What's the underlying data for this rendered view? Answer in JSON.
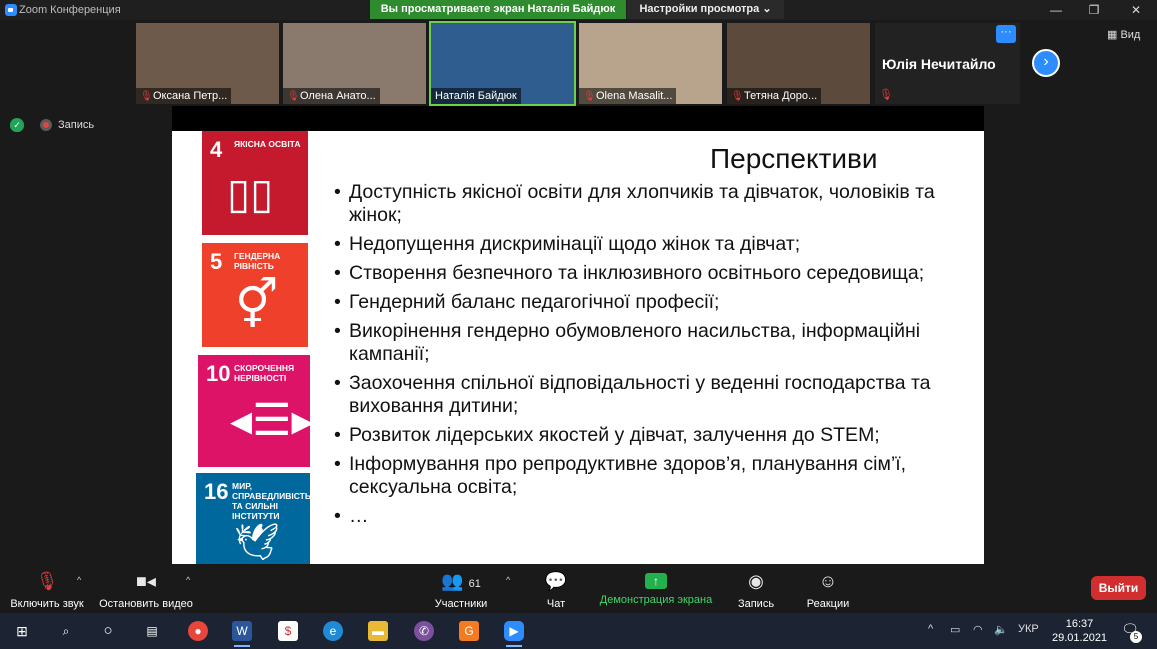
{
  "window": {
    "title": "Zoom Конференция",
    "share_banner": "Вы просматриваете экран Наталія Байдюк",
    "view_options": "Настройки просмотра ⌄",
    "controls": [
      "—",
      "❐",
      "✕"
    ]
  },
  "participants_strip": {
    "tiles": [
      {
        "name": "Оксана Петр...",
        "muted": true,
        "bg": "#6d5a4b"
      },
      {
        "name": "Олена Анато...",
        "muted": true,
        "bg": "#8a7a6e"
      },
      {
        "name": "Наталія Байдюк",
        "muted": false,
        "active": true,
        "bg": "#2f5d8f"
      },
      {
        "name": "Olena Masalit...",
        "muted": true,
        "bg": "#b8a48c"
      },
      {
        "name": "Тетяна Доро...",
        "muted": true,
        "bg": "#5c4a3c"
      }
    ],
    "name_only_tile": {
      "name": "Юлія Нечитайло",
      "more": "···"
    },
    "view_button": "Вид"
  },
  "recording": {
    "label": "Запись"
  },
  "slide": {
    "title": "Перспективи",
    "bullets": [
      "Доступність якісної освіти для хлопчиків та дівчаток, чоловіків та жінок;",
      "Недопущення дискримінації щодо жінок та дівчат;",
      "Створення безпечного та інклюзивного освітнього середовища;",
      "Гендерний баланс педагогічної професії;",
      "Викорінення гендерно обумовленого насильства, інформаційні кампанії;",
      "Заохочення спільної відповідальності у веденні господарства та виховання дитини;",
      "Розвиток лідерських якостей у дівчат, залучення до STEM;",
      "Інформування про репродуктивне здоров’я, планування сім’ї, сексуальна освіта;",
      "…"
    ],
    "sdg_tiles": [
      {
        "num": "4",
        "label": "Якісна освіта",
        "color": "#c5192d",
        "icon": "📖"
      },
      {
        "num": "5",
        "label": "Гендерна рівність",
        "color": "#ef402b",
        "icon": "⚥"
      },
      {
        "num": "10",
        "label": "Скорочення нерівності",
        "color": "#dd1367",
        "icon": "⇔"
      },
      {
        "num": "16",
        "label": "Мир, справедливість та сильні інститути",
        "color": "#00689d",
        "icon": "🕊"
      }
    ]
  },
  "toolbar": {
    "mute": "Включить звук",
    "video": "Остановить видео",
    "participants": "Участники",
    "participants_count": "61",
    "chat": "Чат",
    "share": "Демонстрация экрана",
    "record": "Запись",
    "reactions": "Реакции",
    "leave": "Выйти"
  },
  "taskbar": {
    "lang": "УКР",
    "time": "16:37",
    "date": "29.01.2021",
    "notifications": "5"
  }
}
